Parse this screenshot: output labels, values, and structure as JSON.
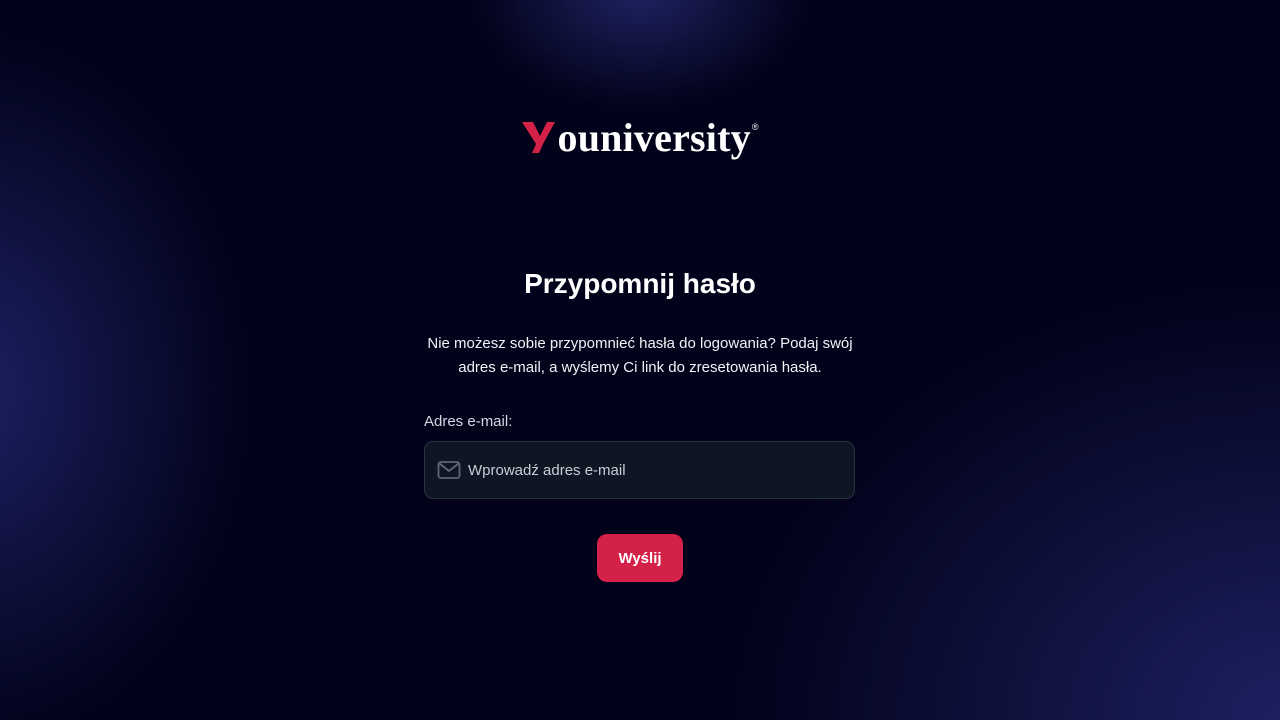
{
  "brand": {
    "name": "ouniversity",
    "registered": "®",
    "accent_color": "#d42147"
  },
  "form": {
    "title": "Przypomnij hasło",
    "description": "Nie możesz sobie przypomnieć hasła do logowania? Podaj swój adres e-mail, a wyślemy Ci link do zresetowania hasła.",
    "email_label": "Adres e-mail:",
    "email_placeholder": "Wprowadź adres e-mail",
    "email_value": "",
    "email_icon": "mail-icon",
    "submit_label": "Wyślij"
  }
}
